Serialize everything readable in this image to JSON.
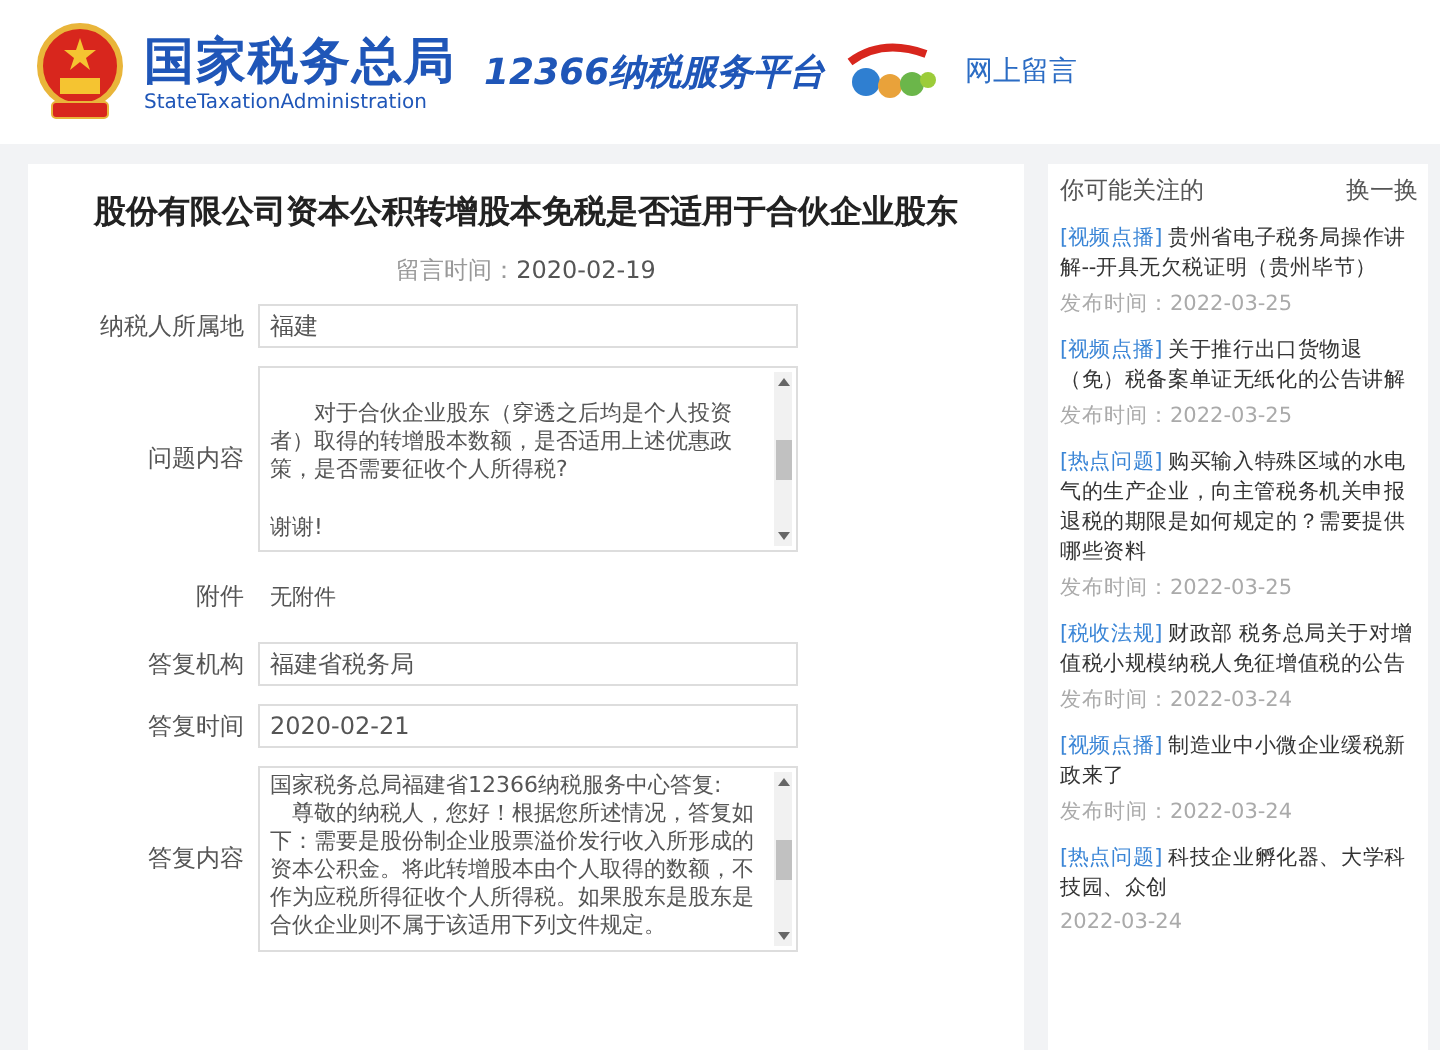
{
  "header": {
    "title": "国家税务总局",
    "subtitle": "StateTaxationAdministration",
    "platform": "12366纳税服务平台",
    "nav_link": "网上留言"
  },
  "message": {
    "title": "股份有限公司资本公积转增股本免税是否适用于合伙企业股东",
    "time_label": "留言时间：",
    "time": "2020-02-19",
    "fields": [
      {
        "kind": "input",
        "label": "纳税人所属地",
        "value": "福建"
      },
      {
        "kind": "spaced_textarea",
        "label": "问题内容",
        "lines": [
          "　　对于合伙企业股东（穿透之后均是个人投资者）取得的转增股本数额，是否适用上述优惠政策，是否需要征收个人所得税?",
          "谢谢!"
        ]
      },
      {
        "kind": "plain",
        "label": "附件",
        "value": "无附件"
      },
      {
        "kind": "input",
        "label": "答复机构",
        "value": "福建省税务局"
      },
      {
        "kind": "input",
        "label": "答复时间",
        "value": "2020-02-21"
      },
      {
        "kind": "textarea",
        "label": "答复内容",
        "lines": [
          "国家税务总局福建省12366纳税服务中心答复:",
          "　尊敬的纳税人，您好！根据您所述情况，答复如下：需要是股份制企业股票溢价发行收入所形成的资本公积金。将此转增股本由个人取得的数额，不作为应税所得征收个人所得税。如果股东是股东是合伙企业则不属于该适用下列文件规定。"
        ]
      }
    ]
  },
  "sidebar": {
    "title": "你可能关注的",
    "refresh": "换一换",
    "items": [
      {
        "tag": "[视频点播]",
        "title": "贵州省电子税务局操作讲解--开具无欠税证明（贵州毕节）",
        "date": "发布时间：2022-03-25"
      },
      {
        "tag": "[视频点播]",
        "title": "关于推行出口货物退（免）税备案单证无纸化的公告讲解",
        "date": "发布时间：2022-03-25"
      },
      {
        "tag": "[热点问题]",
        "title": "购买输入特殊区域的水电气的生产企业，向主管税务机关申报退税的期限是如何规定的？需要提供哪些资料",
        "date": "发布时间：2022-03-25"
      },
      {
        "tag": "[税收法规]",
        "title": "财政部 税务总局关于对增值税小规模纳税人免征增值税的公告",
        "date": "发布时间：2022-03-24"
      },
      {
        "tag": "[视频点播]",
        "title": "制造业中小微企业缓税新政来了",
        "date": "发布时间：2022-03-24"
      },
      {
        "tag": "[热点问题]",
        "title": "科技企业孵化器、大学科技园、众创",
        "date": "2022-03-24"
      }
    ]
  }
}
